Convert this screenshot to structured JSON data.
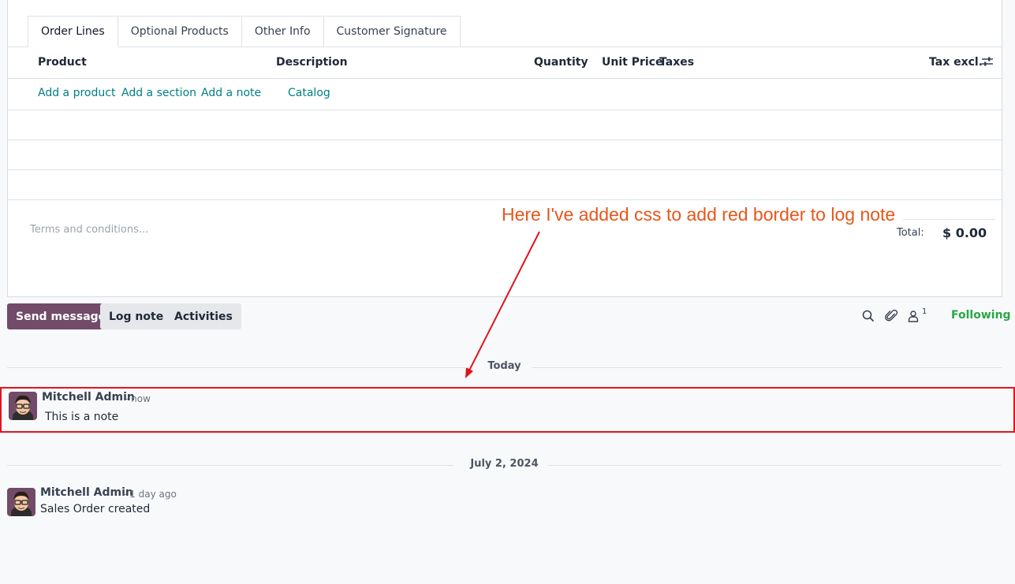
{
  "tabs": [
    "Order Lines",
    "Optional Products",
    "Other Info",
    "Customer Signature"
  ],
  "columns": {
    "product": "Product",
    "description": "Description",
    "quantity": "Quantity",
    "unit_price": "Unit Price",
    "taxes": "Taxes",
    "tax_excl": "Tax excl."
  },
  "add_links": {
    "product": "Add a product",
    "section": "Add a section",
    "note": "Add a note",
    "catalog": "Catalog"
  },
  "terms_placeholder": "Terms and conditions...",
  "total": {
    "label": "Total:",
    "value": "$ 0.00"
  },
  "annotation": "Here I've added css to add red border to log note",
  "chatter": {
    "send_message": "Send message",
    "log_note": "Log note",
    "activities": "Activities",
    "follower_count": "1",
    "following": "Following"
  },
  "separators": {
    "today": "Today",
    "past": "July 2, 2024"
  },
  "messages": [
    {
      "author": "Mitchell Admin",
      "when": "- now",
      "body": "This is a note"
    },
    {
      "author": "Mitchell Admin",
      "when": "- 1 day ago",
      "body": "Sales Order created"
    }
  ],
  "colors": {
    "accent": "#714b67",
    "link": "#017e84",
    "following": "#28a745",
    "annotation": "#e8561b",
    "highlight_border": "#e0141e"
  },
  "icons": [
    "settings-sliders-icon",
    "search-icon",
    "paperclip-icon",
    "follower-user-icon",
    "avatar-icon",
    "arrow-annotation"
  ]
}
